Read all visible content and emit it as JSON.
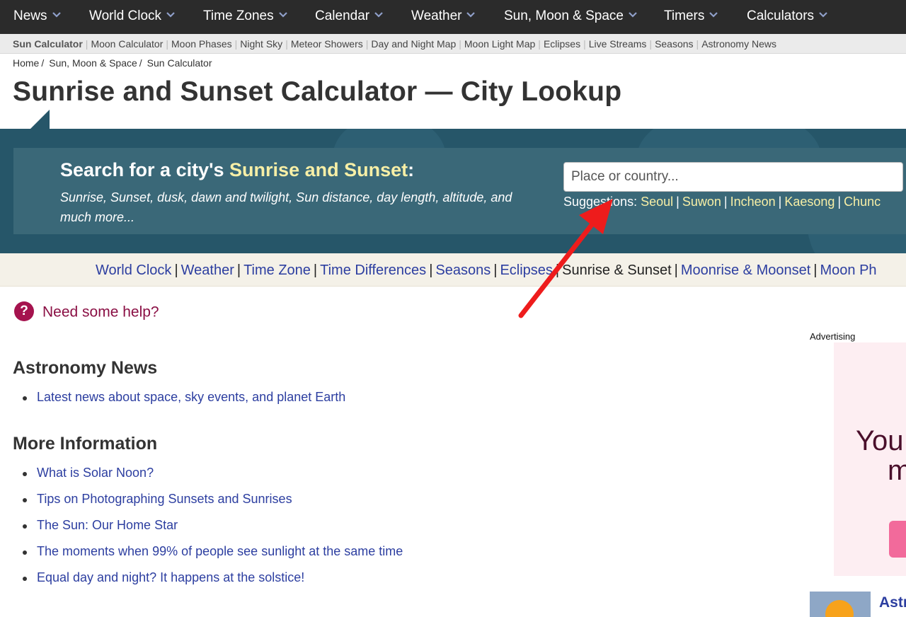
{
  "topnav": {
    "items": [
      "News",
      "World Clock",
      "Time Zones",
      "Calendar",
      "Weather",
      "Sun, Moon & Space",
      "Timers",
      "Calculators"
    ]
  },
  "subnav": {
    "items": [
      "Sun Calculator",
      "Moon Calculator",
      "Moon Phases",
      "Night Sky",
      "Meteor Showers",
      "Day and Night Map",
      "Moon Light Map",
      "Eclipses",
      "Live Streams",
      "Seasons",
      "Astronomy News"
    ],
    "active": "Sun Calculator"
  },
  "breadcrumb": [
    "Home",
    "Sun, Moon & Space",
    "Sun Calculator"
  ],
  "page_title": "Sunrise and Sunset Calculator — City Lookup",
  "hero": {
    "heading_prefix": "Search for a city's",
    "heading_highlight": "Sunrise and Sunset",
    "heading_suffix": ":",
    "subtitle": "Sunrise, Sunset, dusk, dawn and twilight, Sun distance, day length, altitude, and much more...",
    "search_placeholder": "Place or country...",
    "suggestions_label": "Suggestions:",
    "suggestions": [
      "Seoul",
      "Suwon",
      "Incheon",
      "Kaesong",
      "Chunc"
    ]
  },
  "section_nav": {
    "items": [
      "World Clock",
      "Weather",
      "Time Zone",
      "Time Differences",
      "Seasons",
      "Eclipses",
      "Sunrise & Sunset",
      "Moonrise & Moonset",
      "Moon Ph"
    ],
    "current": "Sunrise & Sunset"
  },
  "help_link": "Need some help?",
  "help_icon": "?",
  "astronomy_news": {
    "title": "Astronomy News",
    "links": [
      "Latest news about space, sky events, and planet Earth"
    ]
  },
  "more_information": {
    "title": "More Information",
    "links": [
      "What is Solar Noon?",
      "Tips on Photographing Sunsets and Sunrises",
      "The Sun: Our Home Star",
      "The moments when 99% of people see sunlight at the same time",
      "Equal day and night? It happens at the solstice!"
    ]
  },
  "advertising": {
    "label": "Advertising",
    "text_line1": "You",
    "text_line2": "m"
  },
  "sidebar_teaser": {
    "title": "Astr"
  },
  "colors": {
    "topnav_bg": "#2b2b2b",
    "hero_bg": "#265669",
    "highlight": "#f7efa6",
    "link": "#2c3ea0",
    "help": "#8a0f44",
    "annotation_arrow": "#ee1c1c"
  },
  "icons": {
    "nav_dropdown": "chevron-down-icon",
    "help": "question-circle-icon",
    "annotation": "red-arrow-icon"
  }
}
